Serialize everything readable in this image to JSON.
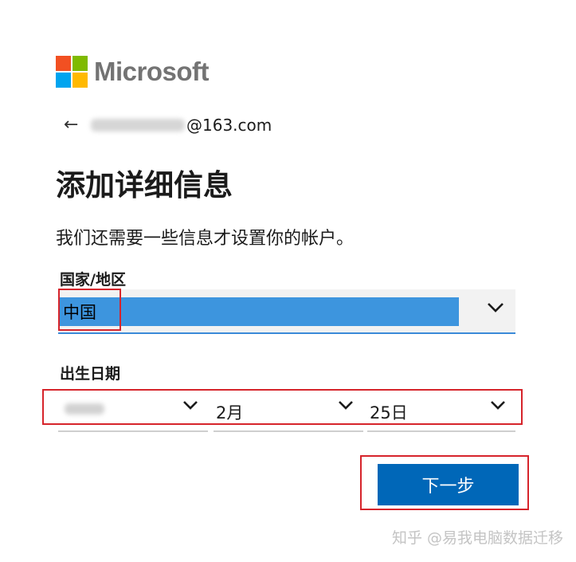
{
  "brand": {
    "name": "Microsoft",
    "colors": {
      "red": "#f25022",
      "green": "#7fba00",
      "blue": "#00a4ef",
      "yellow": "#ffb900"
    }
  },
  "identity": {
    "back_icon": "left-arrow-icon",
    "email_suffix": "@163.com"
  },
  "page": {
    "title": "添加详细信息",
    "subtitle": "我们还需要一些信息才设置你的帐户。"
  },
  "form": {
    "country": {
      "label": "国家/地区",
      "value": "中国"
    },
    "birthdate": {
      "label": "出生日期",
      "year": "",
      "month": "2月",
      "day": "25日"
    },
    "next_label": "下一步"
  },
  "watermark": "知乎 @易我电脑数据迁移",
  "colors": {
    "accent": "#0067b8",
    "selection": "#3d95de",
    "highlight_box": "#d6242b"
  }
}
